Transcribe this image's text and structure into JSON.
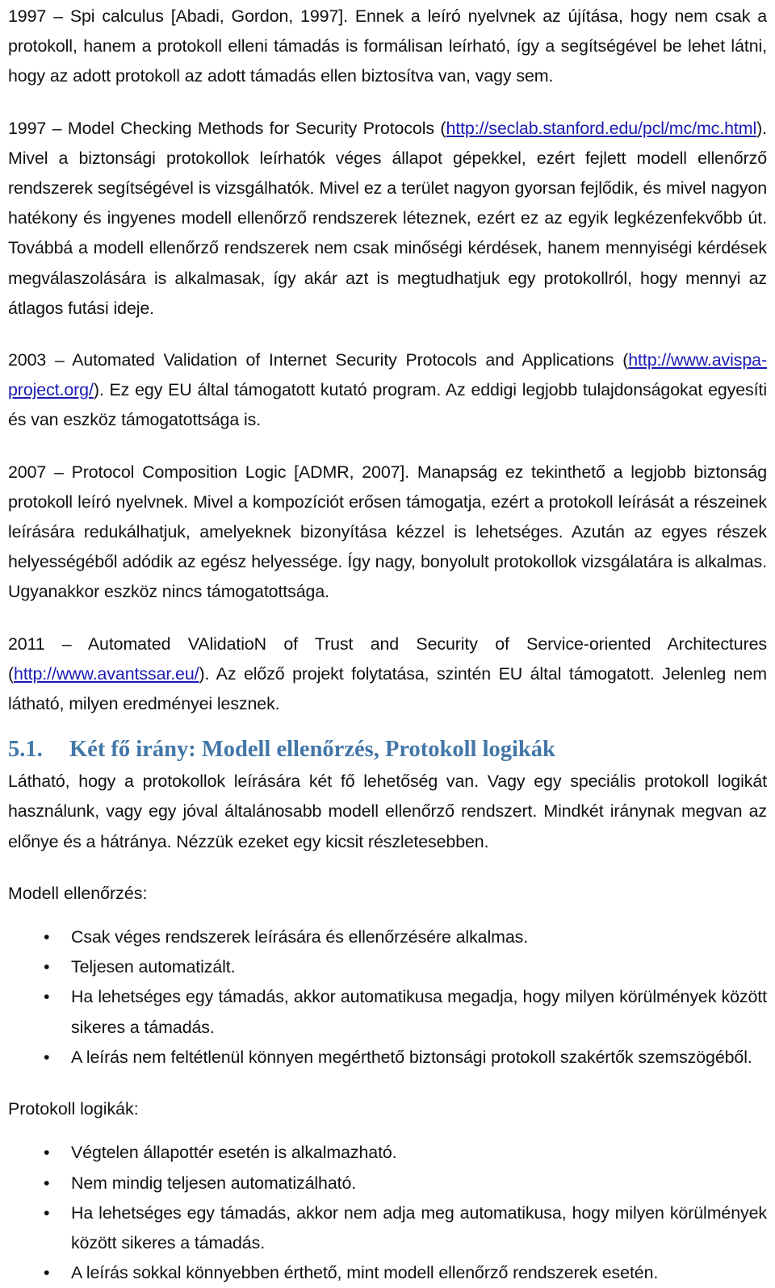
{
  "document": {
    "paragraphs": [
      {
        "id": "p-1997-spi",
        "segments": [
          {
            "type": "text",
            "text": "1997 – Spi calculus [Abadi, Gordon, 1997]. Ennek a leíró nyelvnek az újítása, hogy nem csak a protokoll, hanem a protokoll elleni támadás is formálisan leírható, így a segítségével be lehet látni, hogy az adott protokoll az adott támadás ellen biztosítva van, vagy sem."
          }
        ]
      },
      {
        "id": "p-1997-model-checking",
        "segments": [
          {
            "type": "text",
            "text": "1997 – Model Checking Methods for Security Protocols ("
          },
          {
            "type": "link",
            "text": "http://seclab.stanford.edu/pcl/mc/mc.html"
          },
          {
            "type": "text",
            "text": "). Mivel a biztonsági protokollok leírhatók véges állapot gépekkel, ezért fejlett modell ellenőrző rendszerek segítségével is vizsgálhatók. Mivel ez a terület nagyon gyorsan fejlődik, és mivel nagyon hatékony és ingyenes modell ellenőrző rendszerek léteznek, ezért ez az egyik legkézenfekvőbb út. Továbbá a modell ellenőrző rendszerek nem csak minőségi kérdések, hanem mennyiségi kérdések megválaszolására is alkalmasak, így akár azt is megtudhatjuk egy protokollról, hogy mennyi az átlagos futási ideje."
          }
        ]
      },
      {
        "id": "p-2003-avispa",
        "segments": [
          {
            "type": "text",
            "text": "2003 – Automated Validation of Internet Security Protocols and Applications ("
          },
          {
            "type": "link",
            "text": "http://www.avispa-project.org/"
          },
          {
            "type": "text",
            "text": "). Ez egy EU által támogatott kutató program. Az eddigi legjobb tulajdonságokat egyesíti és van eszköz támogatottsága is."
          }
        ]
      },
      {
        "id": "p-2007-pcl",
        "segments": [
          {
            "type": "text",
            "text": "2007 – Protocol Composition Logic [ADMR, 2007]. Manapság ez tekinthető a legjobb biztonság protokoll leíró nyelvnek. Mivel a kompozíciót erősen támogatja, ezért a protokoll leírását a részeinek leírására redukálhatjuk, amelyeknek bizonyítása kézzel is lehetséges. Azután az egyes részek helyességéből adódik az egész helyessége. Így nagy, bonyolult protokollok vizsgálatára is alkalmas. Ugyanakkor eszköz nincs támogatottsága."
          }
        ]
      },
      {
        "id": "p-2011-avantssar",
        "segments": [
          {
            "type": "text",
            "text": "2011 – Automated VAlidatioN of Trust and Security of Service-oriented Architectures ("
          },
          {
            "type": "link",
            "text": "http://www.avantssar.eu/"
          },
          {
            "type": "text",
            "text": "). Az előző projekt folytatása, szintén EU által támogatott. Jelenleg nem látható, milyen eredményei lesznek."
          }
        ]
      }
    ],
    "section": {
      "number": "5.1.",
      "title": "Két fő irány: Modell ellenőrzés, Protokoll logikák",
      "color": "#4277a8"
    },
    "section_intro": "Látható, hogy a protokollok leírására két fő lehetőség van. Vagy egy speciális protokoll logikát használunk, vagy egy jóval általánosabb modell ellenőrző rendszert. Mindkét iránynak megvan az előnye és a hátránya. Nézzük ezeket egy kicsit részletesebben.",
    "list_one": {
      "label": "Modell ellenőrzés:",
      "bullet_glyph": "•",
      "items": [
        "Csak véges rendszerek leírására és ellenőrzésére alkalmas.",
        "Teljesen automatizált.",
        "Ha lehetséges egy támadás, akkor automatikusa megadja, hogy milyen körülmények között sikeres a támadás.",
        "A leírás nem feltétlenül könnyen megérthető biztonsági protokoll szakértők szemszögéből."
      ]
    },
    "list_two": {
      "label": "Protokoll logikák:",
      "bullet_glyph": "•",
      "items": [
        "Végtelen állapottér esetén is alkalmazható.",
        "Nem mindig teljesen automatizálható.",
        "Ha lehetséges egy támadás, akkor nem adja meg automatikusa, hogy milyen körülmények között sikeres a támadás.",
        "A leírás sokkal könnyebben érthető, mint modell ellenőrző rendszerek esetén."
      ]
    },
    "colors": {
      "link": "#1a1ab4",
      "heading": "#4277a8",
      "body_text": "#111111"
    }
  }
}
